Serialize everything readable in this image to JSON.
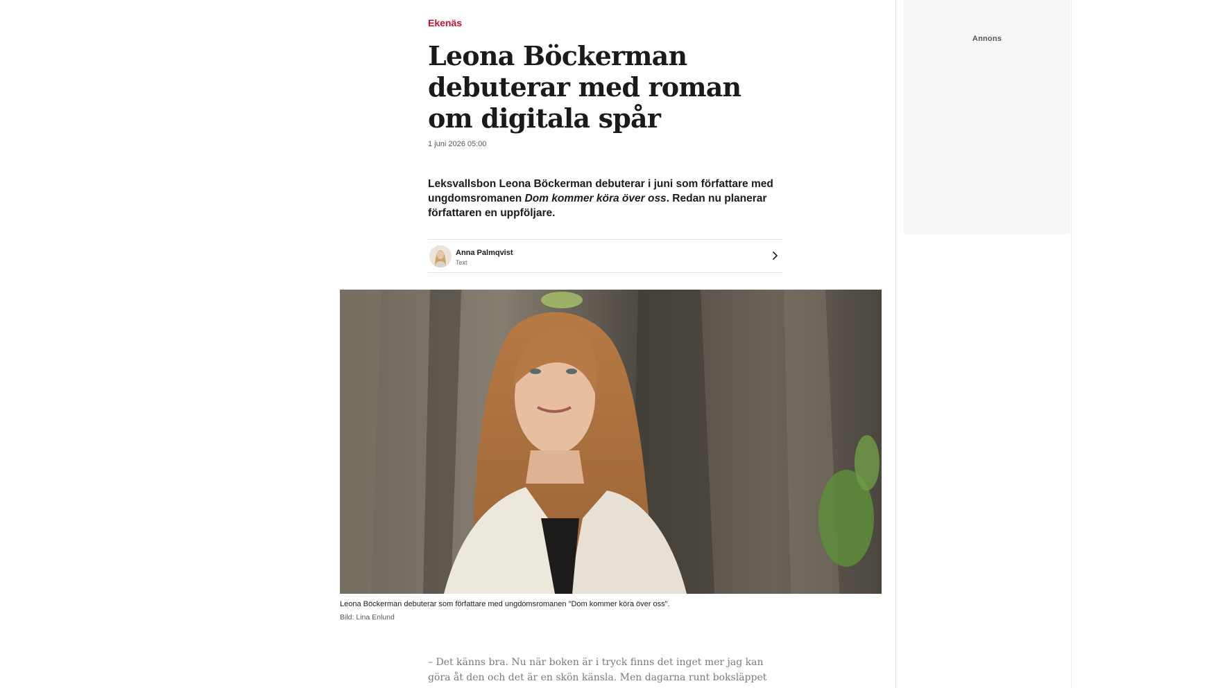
{
  "article": {
    "section": "Ekenäs",
    "headline": "Leona Böckerman debuterar med roman om digitala spår",
    "date": "1 juni 2026 05:00",
    "lead": {
      "before": "Leksvallsbon Leona Böckerman debuterar i juni som författare med ungdomsromanen ",
      "book_title": "Dom kommer köra över oss",
      "after": ". Redan nu planerar författaren en uppföljare."
    },
    "author": {
      "name": "Anna Palmqvist",
      "role": "Text"
    },
    "image": {
      "caption": "Leona Böckerman debuterar som författare med ungdomsromanen \"Dom kommer köra över oss\".",
      "credit": "Bild: Lina Enlund"
    },
    "body_start": "– Det känns bra. Nu när boken är i tryck finns det inget mer jag kan göra åt den och det är en skön känsla. Men dagarna runt boksläppet kommer nog"
  },
  "sidebar": {
    "ad_label": "Annons"
  },
  "colors": {
    "section_accent": "#c8102e",
    "ad_background": "#f6f7f9"
  },
  "icons": {
    "author_link": "chevron-right-icon"
  }
}
